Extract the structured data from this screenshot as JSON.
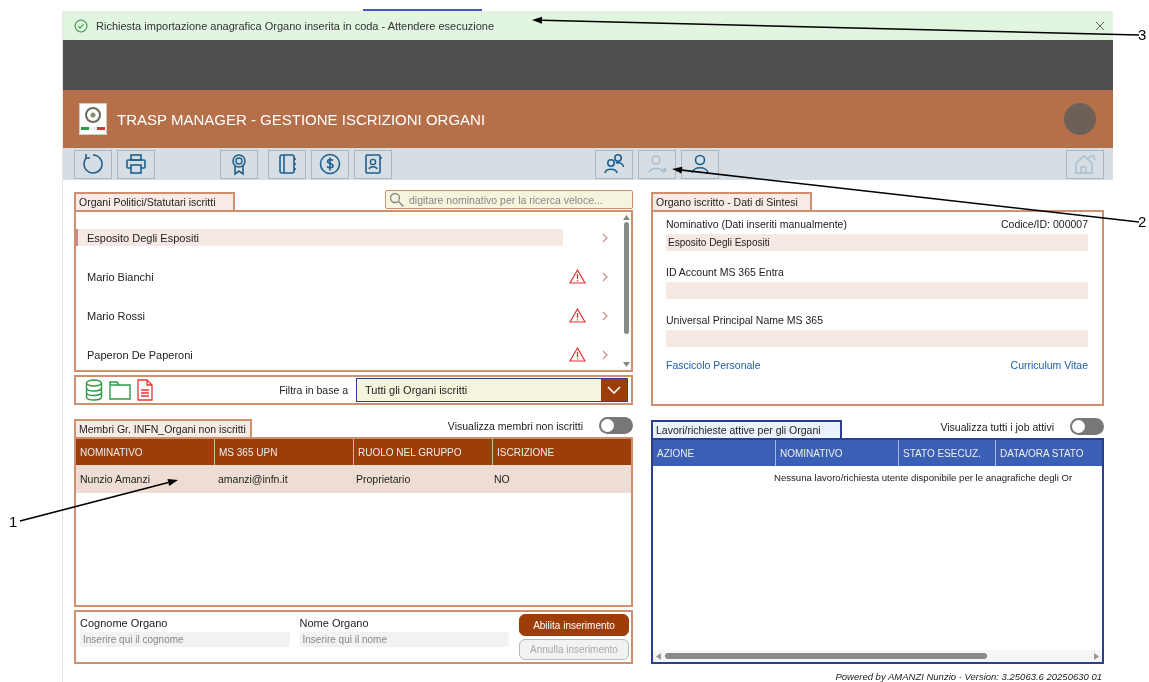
{
  "notification": {
    "kind": "success",
    "text": "Richiesta importazione anagrafica Organo inserita in coda - Attendere esecuzione"
  },
  "header": {
    "title": "TRASP MANAGER - GESTIONE ISCRIZIONI ORGANI"
  },
  "toolbar": [
    {
      "buttons": [
        {
          "kind": "refresh",
          "disabled": false
        },
        {
          "kind": "print",
          "disabled": false
        }
      ]
    },
    {
      "buttons": [
        {
          "kind": "award",
          "disabled": false
        }
      ]
    },
    {
      "buttons": [
        {
          "kind": "notebook",
          "disabled": false
        },
        {
          "kind": "dollar",
          "disabled": false
        },
        {
          "kind": "contact",
          "disabled": false
        }
      ]
    },
    {
      "buttons": [
        {
          "kind": "users",
          "disabled": false
        },
        {
          "kind": "user-add",
          "disabled": true
        },
        {
          "kind": "user",
          "disabled": false
        }
      ]
    },
    {
      "buttons": [
        {
          "kind": "house",
          "disabled": true
        }
      ]
    }
  ],
  "organs": {
    "title": "Organi Politici/Statutari iscritti",
    "search_placeholder": "digitare nominativo per la ricerca veloce...",
    "items": [
      {
        "name": "Esposito Degli Espositi",
        "selected": true,
        "warning": false
      },
      {
        "name": "Mario Bianchi",
        "selected": false,
        "warning": true
      },
      {
        "name": "Mario Rossi",
        "selected": false,
        "warning": true
      },
      {
        "name": "Paperon De Paperoni",
        "selected": false,
        "warning": true
      }
    ],
    "filter_label": "Filtra in base a",
    "filter_value": "Tutti gli Organi iscritti"
  },
  "members": {
    "title": "Membri Gr. INFN_Organi non iscritti",
    "toggle_label": "Visualizza membri non iscritti",
    "toggle_on": false,
    "columns": [
      "NOMINATIVO",
      "MS 365 UPN",
      "RUOLO NEL GRUPPO",
      "ISCRIZIONE"
    ],
    "rows": [
      {
        "cells": [
          "Nunzio Amanzi",
          "amanzi@infn.it",
          "Proprietario",
          "NO"
        ],
        "selected": true
      }
    ]
  },
  "new_organ": {
    "fields": [
      {
        "label": "Cognome Organo",
        "placeholder": "Inserire qui il cognome"
      },
      {
        "label": "Nome Organo",
        "placeholder": "Inserire qui il nome"
      }
    ],
    "buttons": [
      {
        "label": "Abilita inserimento",
        "disabled": false
      },
      {
        "label": "Annulla inserimento",
        "disabled": true
      }
    ]
  },
  "summary": {
    "title": "Organo iscritto - Dati di Sintesi",
    "code": "Codice/ID: 000007",
    "fields": [
      {
        "label": "Nominativo (Dati inseriti manualmente)",
        "value": "Esposito Degli Espositi"
      },
      {
        "label": "ID Account MS 365 Entra"
      },
      {
        "label": "Universal Principal Name MS 365"
      }
    ],
    "links": [
      "Fascicolo Personale",
      "Curriculum Vitae"
    ]
  },
  "jobs": {
    "title": "Lavori/richieste attive per gli Organi",
    "toggle_label": "Visualizza tutti i job attivi",
    "toggle_on": false,
    "columns": [
      "AZIONE",
      "NOMINATIVO",
      "STATO ESECUZ.",
      "DATA/ORA STATO"
    ],
    "empty_message": "Nessuna lavoro/richiesta utente disponibile per le anagrafiche degli Or"
  },
  "footer": "Powered by AMANZI Nunzio - Version: 3.25063.6 20250630 01",
  "callouts": [
    {
      "label": "3"
    },
    {
      "label": "2"
    },
    {
      "label": "1"
    }
  ]
}
